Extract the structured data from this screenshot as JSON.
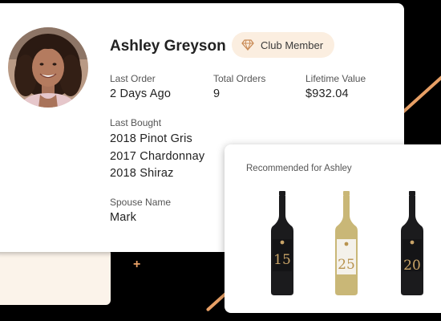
{
  "profile": {
    "name": "Ashley Greyson",
    "badge_label": "Club Member",
    "badge_icon": "diamond-icon",
    "last_order": {
      "label": "Last Order",
      "value": "2 Days Ago"
    },
    "total_orders": {
      "label": "Total Orders",
      "value": "9"
    },
    "lifetime_value": {
      "label": "Lifetime Value",
      "value": "$932.04"
    },
    "last_bought": {
      "label": "Last Bought",
      "items": [
        "2018 Pinot Gris",
        "2017 Chardonnay",
        "2018 Shiraz"
      ]
    },
    "spouse": {
      "label": "Spouse Name",
      "value": "Mark"
    }
  },
  "recommendations": {
    "title": "Recommended for Ashley",
    "bottles": [
      {
        "label_number": "15",
        "glass_color": "#1b1b1d",
        "label_color": "#141416",
        "text_color": "#c9a468"
      },
      {
        "label_number": "25",
        "glass_color": "#c9b777",
        "label_color": "#f4f1ea",
        "text_color": "#b8934f"
      },
      {
        "label_number": "20",
        "glass_color": "#1b1b1d",
        "label_color": "#141416",
        "text_color": "#c9a468"
      }
    ]
  },
  "colors": {
    "accent": "#e8a066",
    "badge_bg": "#fbeee0",
    "cream": "#fbf3ea",
    "background": "#000000"
  }
}
